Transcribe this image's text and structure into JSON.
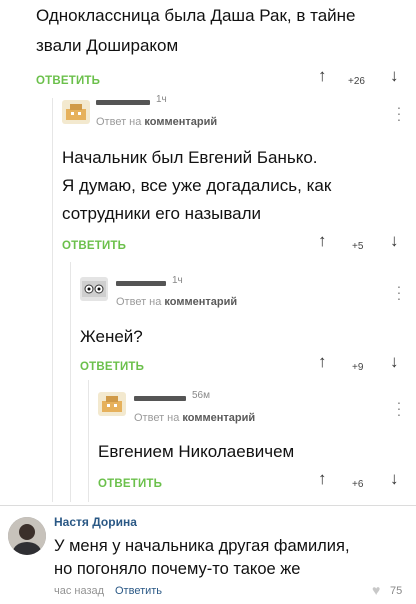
{
  "comments": [
    {
      "text_lines": [
        "Одноклассница была Даша Рак, в тайне",
        "звали Дошираком"
      ],
      "reply": "ОТВЕТИТЬ",
      "score": "+26"
    },
    {
      "time": "1ч",
      "reply_to": "Ответ на",
      "reply_to_target": "комментарий",
      "text_lines": [
        "Начальник был Евгений Банько.",
        "Я думаю, все уже догадались, как",
        "сотрудники его называли"
      ],
      "reply": "ОТВЕТИТЬ",
      "score": "+5"
    },
    {
      "time": "1ч",
      "reply_to": "Ответ на",
      "reply_to_target": "комментарий",
      "text_lines": [
        "Женей?"
      ],
      "reply": "ОТВЕТИТЬ",
      "score": "+9"
    },
    {
      "time": "56м",
      "reply_to": "Ответ на",
      "reply_to_target": "комментарий",
      "text_lines": [
        "Евгением Николаевичем"
      ],
      "reply": "ОТВЕТИТЬ",
      "score": "+6"
    }
  ],
  "bottom_comment": {
    "author": "Настя Дорина",
    "text_lines": [
      "У меня у начальника другая фамилия,",
      "но погоняло почему-то такое же"
    ],
    "time": "час назад",
    "reply": "Ответить",
    "likes": "75"
  },
  "colors": {
    "reply_green": "#6bc04b",
    "vk_blue": "#2a5885",
    "heart": "#c8c8c8"
  }
}
